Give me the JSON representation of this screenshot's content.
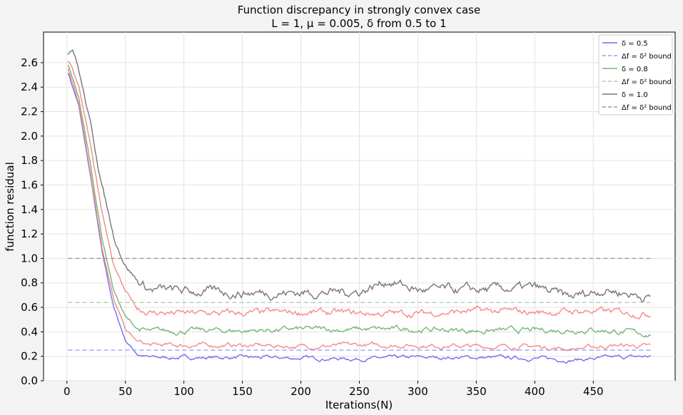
{
  "chart_data": {
    "type": "line",
    "title": "Function discrepancy in strongly convex case",
    "subtitle": "L = 1, μ = 0.005, δ from 0.5 to 1",
    "xlabel": "Iterations(N)",
    "ylabel": "function residual",
    "xlim": [
      -20,
      520
    ],
    "ylim": [
      0.0,
      2.85
    ],
    "x_ticks": [
      0,
      50,
      100,
      150,
      200,
      250,
      300,
      350,
      400,
      450
    ],
    "y_ticks": [
      0.0,
      0.2,
      0.4,
      0.6,
      0.8,
      1.0,
      1.2,
      1.4,
      1.6,
      1.8,
      2.0,
      2.2,
      2.4,
      2.6
    ],
    "grid": true,
    "legend_position": "top-right",
    "series": [
      {
        "name": "δ = 0.5",
        "color": "#6f6ff0",
        "style": "solid",
        "legend": true,
        "points": [
          [
            1,
            2.52
          ],
          [
            10,
            2.25
          ],
          [
            20,
            1.68
          ],
          [
            30,
            1.05
          ],
          [
            40,
            0.6
          ],
          [
            50,
            0.33
          ],
          [
            60,
            0.22
          ],
          [
            70,
            0.19
          ],
          [
            100,
            0.19
          ],
          [
            150,
            0.19
          ],
          [
            200,
            0.185
          ],
          [
            250,
            0.18
          ],
          [
            300,
            0.19
          ],
          [
            350,
            0.19
          ],
          [
            400,
            0.185
          ],
          [
            430,
            0.17
          ],
          [
            470,
            0.19
          ],
          [
            499,
            0.2
          ]
        ],
        "noise": 0.01
      },
      {
        "name": "Δf = δ² bound",
        "color": "#9e9ef5",
        "style": "dashed",
        "legend": true,
        "points": [
          [
            1,
            0.25
          ],
          [
            499,
            0.25
          ]
        ]
      },
      {
        "name": "δ = 0.8",
        "color": "#72b872",
        "style": "solid",
        "legend": true,
        "points": [
          [
            1,
            2.58
          ],
          [
            10,
            2.32
          ],
          [
            20,
            1.78
          ],
          [
            30,
            1.17
          ],
          [
            40,
            0.74
          ],
          [
            50,
            0.52
          ],
          [
            60,
            0.43
          ],
          [
            70,
            0.4
          ],
          [
            100,
            0.41
          ],
          [
            150,
            0.41
          ],
          [
            200,
            0.42
          ],
          [
            250,
            0.42
          ],
          [
            300,
            0.42
          ],
          [
            350,
            0.41
          ],
          [
            400,
            0.41
          ],
          [
            450,
            0.42
          ],
          [
            499,
            0.38
          ]
        ],
        "noise": 0.015
      },
      {
        "name": "Δf = δ² bound",
        "color": "#a6d4a6",
        "style": "dashed",
        "legend": true,
        "points": [
          [
            1,
            0.64
          ],
          [
            499,
            0.64
          ]
        ]
      },
      {
        "name": "δ = 1.0",
        "color": "#777777",
        "style": "solid",
        "legend": true,
        "points": [
          [
            1,
            2.68
          ],
          [
            5,
            2.72
          ],
          [
            10,
            2.55
          ],
          [
            20,
            2.1
          ],
          [
            30,
            1.6
          ],
          [
            40,
            1.18
          ],
          [
            50,
            0.95
          ],
          [
            60,
            0.82
          ],
          [
            70,
            0.75
          ],
          [
            100,
            0.73
          ],
          [
            150,
            0.72
          ],
          [
            200,
            0.72
          ],
          [
            250,
            0.73
          ],
          [
            275,
            0.82
          ],
          [
            300,
            0.74
          ],
          [
            350,
            0.74
          ],
          [
            400,
            0.76
          ],
          [
            430,
            0.68
          ],
          [
            460,
            0.75
          ],
          [
            499,
            0.68
          ]
        ],
        "noise": 0.025
      },
      {
        "name": "Δf = δ² bound",
        "color": "#999999",
        "style": "dashed",
        "legend": true,
        "points": [
          [
            1,
            1.0
          ],
          [
            499,
            1.0
          ]
        ]
      },
      {
        "color": "#f48a8a",
        "style": "solid",
        "legend": false,
        "points": [
          [
            1,
            2.55
          ],
          [
            10,
            2.28
          ],
          [
            20,
            1.72
          ],
          [
            30,
            1.1
          ],
          [
            40,
            0.66
          ],
          [
            50,
            0.42
          ],
          [
            60,
            0.32
          ],
          [
            70,
            0.29
          ],
          [
            100,
            0.29
          ],
          [
            150,
            0.29
          ],
          [
            200,
            0.28
          ],
          [
            250,
            0.29
          ],
          [
            300,
            0.29
          ],
          [
            350,
            0.28
          ],
          [
            400,
            0.28
          ],
          [
            430,
            0.26
          ],
          [
            470,
            0.29
          ],
          [
            499,
            0.28
          ]
        ],
        "noise": 0.012
      },
      {
        "color": "#f48a8a",
        "style": "solid",
        "legend": false,
        "points": [
          [
            1,
            2.62
          ],
          [
            10,
            2.42
          ],
          [
            20,
            1.95
          ],
          [
            30,
            1.38
          ],
          [
            40,
            0.93
          ],
          [
            50,
            0.72
          ],
          [
            60,
            0.6
          ],
          [
            70,
            0.56
          ],
          [
            100,
            0.55
          ],
          [
            150,
            0.55
          ],
          [
            200,
            0.56
          ],
          [
            250,
            0.55
          ],
          [
            300,
            0.55
          ],
          [
            350,
            0.57
          ],
          [
            400,
            0.56
          ],
          [
            450,
            0.57
          ],
          [
            499,
            0.55
          ]
        ],
        "noise": 0.018
      }
    ]
  }
}
